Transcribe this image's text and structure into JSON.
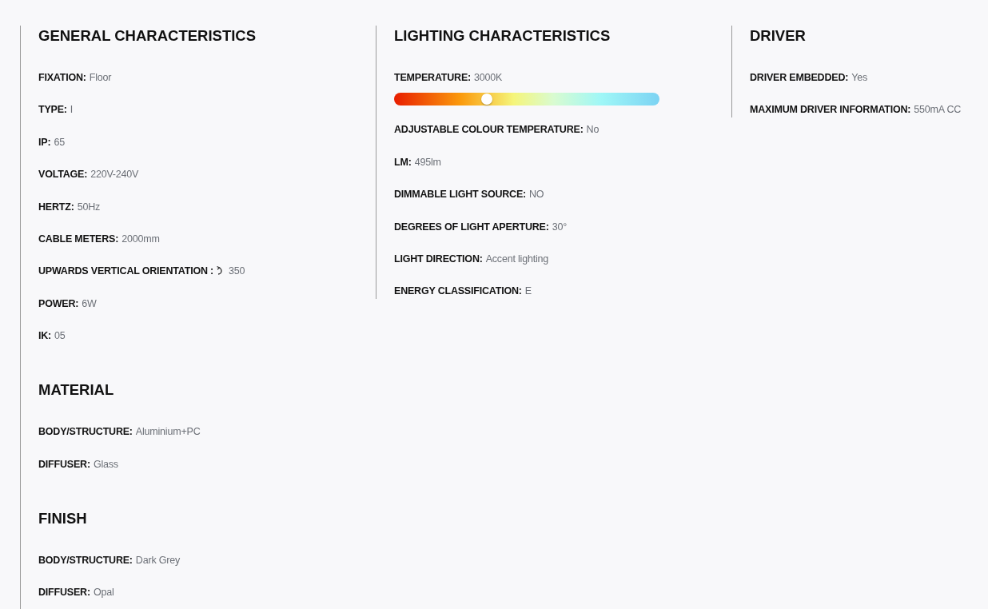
{
  "columns": [
    {
      "sections": [
        {
          "heading": "GENERAL CHARACTERISTICS",
          "rows": [
            {
              "kind": "text",
              "label": "FIXATION:",
              "value": "Floor"
            },
            {
              "kind": "text",
              "label": "TYPE:",
              "value": "I"
            },
            {
              "kind": "text",
              "label": "IP:",
              "value": "65"
            },
            {
              "kind": "text",
              "label": "VOLTAGE:",
              "value": "220V-240V"
            },
            {
              "kind": "text",
              "label": "HERTZ:",
              "value": "50Hz"
            },
            {
              "kind": "text",
              "label": "CABLE METERS:",
              "value": "2000mm"
            },
            {
              "kind": "rotation",
              "label": "UPWARDS VERTICAL ORIENTATION :",
              "value": "350"
            },
            {
              "kind": "text",
              "label": "POWER:",
              "value": "6W"
            },
            {
              "kind": "text",
              "label": "IK:",
              "value": "05"
            }
          ]
        },
        {
          "heading": "MATERIAL",
          "rows": [
            {
              "kind": "text",
              "label": "BODY/STRUCTURE:",
              "value": "Aluminium+PC"
            },
            {
              "kind": "text",
              "label": "DIFFUSER:",
              "value": "Glass"
            }
          ]
        },
        {
          "heading": "FINISH",
          "rows": [
            {
              "kind": "text",
              "label": "BODY/STRUCTURE:",
              "value": "Dark Grey"
            },
            {
              "kind": "text",
              "label": "DIFFUSER:",
              "value": "Opal"
            }
          ]
        }
      ]
    },
    {
      "sections": [
        {
          "heading": "LIGHTING CHARACTERISTICS",
          "rows": [
            {
              "kind": "slider",
              "label": "TEMPERATURE:",
              "value": "3000K",
              "level": 0.35
            },
            {
              "kind": "text",
              "label": "ADJUSTABLE COLOUR TEMPERATURE:",
              "value": "No"
            },
            {
              "kind": "text",
              "label": "LM:",
              "value": "495lm"
            },
            {
              "kind": "text",
              "label": "DIMMABLE LIGHT SOURCE:",
              "value": "NO"
            },
            {
              "kind": "text",
              "label": "DEGREES OF LIGHT APERTURE:",
              "value": "30°"
            },
            {
              "kind": "text",
              "label": "LIGHT DIRECTION:",
              "value": "Accent lighting"
            },
            {
              "kind": "text",
              "label": "ENERGY CLASSIFICATION:",
              "value": "E"
            }
          ]
        }
      ]
    },
    {
      "sections": [
        {
          "heading": "DRIVER",
          "rows": [
            {
              "kind": "text",
              "label": "DRIVER EMBEDDED:",
              "value": "Yes"
            },
            {
              "kind": "text",
              "label": "MAXIMUM DRIVER INFORMATION:",
              "value": "550mA CC"
            }
          ]
        }
      ]
    }
  ]
}
